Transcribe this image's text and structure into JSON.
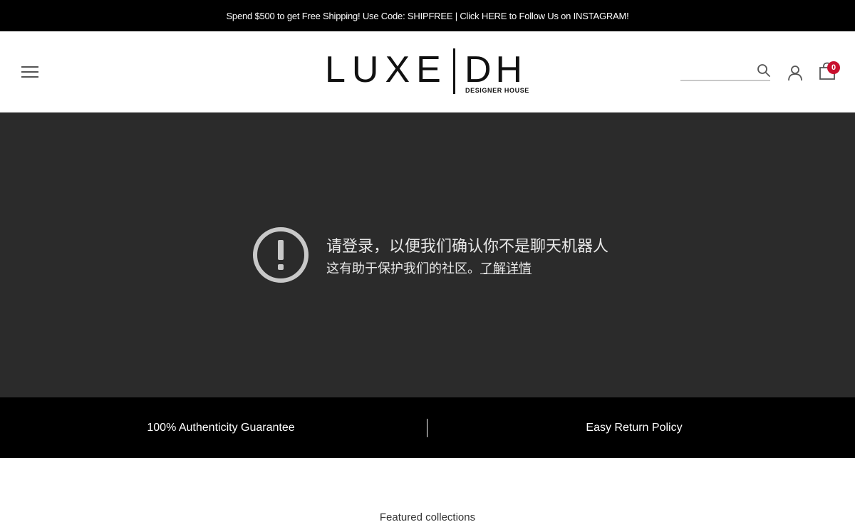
{
  "announcement": {
    "text": "Spend $500 to get Free Shipping! Use Code: SHIPFREE | Click HERE to Follow Us on INSTAGRAM!"
  },
  "header": {
    "logo_main": "LUXE",
    "logo_right": "DH",
    "logo_sub": "DESIGNER HOUSE",
    "search_placeholder": "",
    "cart_count": "0",
    "icons": [
      "hamburger-menu-icon",
      "search-icon",
      "account-icon",
      "cart-icon"
    ]
  },
  "notice": {
    "title": "请登录，以便我们确认你不是聊天机器人",
    "subtitle": "这有助于保护我们的社区。",
    "learn_more": "了解详情"
  },
  "guarantees": {
    "left": "100% Authenticity Guarantee",
    "right": "Easy Return Policy"
  },
  "featured": {
    "heading": "Featured collections"
  },
  "colors": {
    "announcement_bg": "#000000",
    "notice_bg": "#2b2b2b",
    "badge": "#c8102e"
  }
}
